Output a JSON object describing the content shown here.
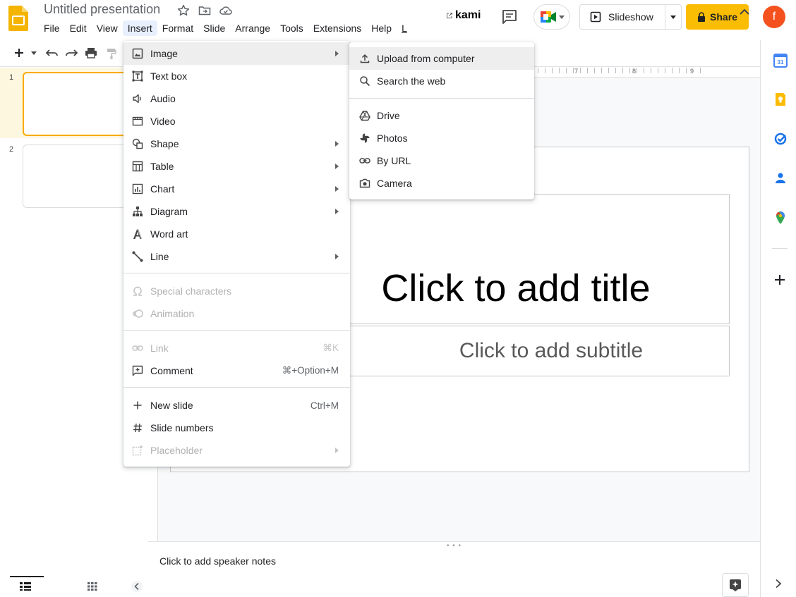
{
  "app": {
    "doc_title": "Untitled presentation",
    "menus": [
      "File",
      "Edit",
      "View",
      "Insert",
      "Format",
      "Slide",
      "Arrange",
      "Tools",
      "Extensions",
      "Help",
      "L"
    ],
    "active_menu": "Insert",
    "kami_label": "kami",
    "slideshow_label": "Slideshow",
    "share_label": "Share",
    "avatar_letter": "f",
    "brand_color": "#fbbc04",
    "avatar_color": "#f4511e"
  },
  "filmstrip": {
    "slide_numbers": [
      "1",
      "2"
    ]
  },
  "ruler": {
    "numbers": [
      "7",
      "8",
      "9"
    ]
  },
  "slide": {
    "title_placeholder": "Click to add title",
    "subtitle_placeholder": "Click to add subtitle"
  },
  "notes": {
    "placeholder": "Click to add speaker notes"
  },
  "insert_menu": {
    "items": [
      {
        "label": "Image",
        "icon": "image-icon",
        "submenu": true
      },
      {
        "label": "Text box",
        "icon": "text-box-icon"
      },
      {
        "label": "Audio",
        "icon": "audio-icon"
      },
      {
        "label": "Video",
        "icon": "video-icon"
      },
      {
        "label": "Shape",
        "icon": "shape-icon",
        "submenu": true
      },
      {
        "label": "Table",
        "icon": "table-icon",
        "submenu": true
      },
      {
        "label": "Chart",
        "icon": "chart-icon",
        "submenu": true
      },
      {
        "label": "Diagram",
        "icon": "diagram-icon",
        "submenu": true
      },
      {
        "label": "Word art",
        "icon": "word-art-icon"
      },
      {
        "label": "Line",
        "icon": "line-icon",
        "submenu": true
      },
      {
        "label": "Special characters",
        "icon": "omega-icon",
        "disabled": true
      },
      {
        "label": "Animation",
        "icon": "animation-icon",
        "disabled": true
      },
      {
        "label": "Link",
        "icon": "link-icon",
        "disabled": true,
        "shortcut": "⌘K"
      },
      {
        "label": "Comment",
        "icon": "comment-icon",
        "shortcut": "⌘+Option+M"
      },
      {
        "label": "New slide",
        "icon": "plus-icon",
        "shortcut": "Ctrl+M"
      },
      {
        "label": "Slide numbers",
        "icon": "hash-icon"
      },
      {
        "label": "Placeholder",
        "icon": "placeholder-icon",
        "disabled": true,
        "submenu": true
      }
    ]
  },
  "image_submenu": {
    "items": [
      {
        "label": "Upload from computer",
        "icon": "upload-icon"
      },
      {
        "label": "Search the web",
        "icon": "search-icon"
      },
      {
        "label": "Drive",
        "icon": "drive-icon"
      },
      {
        "label": "Photos",
        "icon": "photos-icon"
      },
      {
        "label": "By URL",
        "icon": "link-icon"
      },
      {
        "label": "Camera",
        "icon": "camera-icon"
      }
    ]
  }
}
